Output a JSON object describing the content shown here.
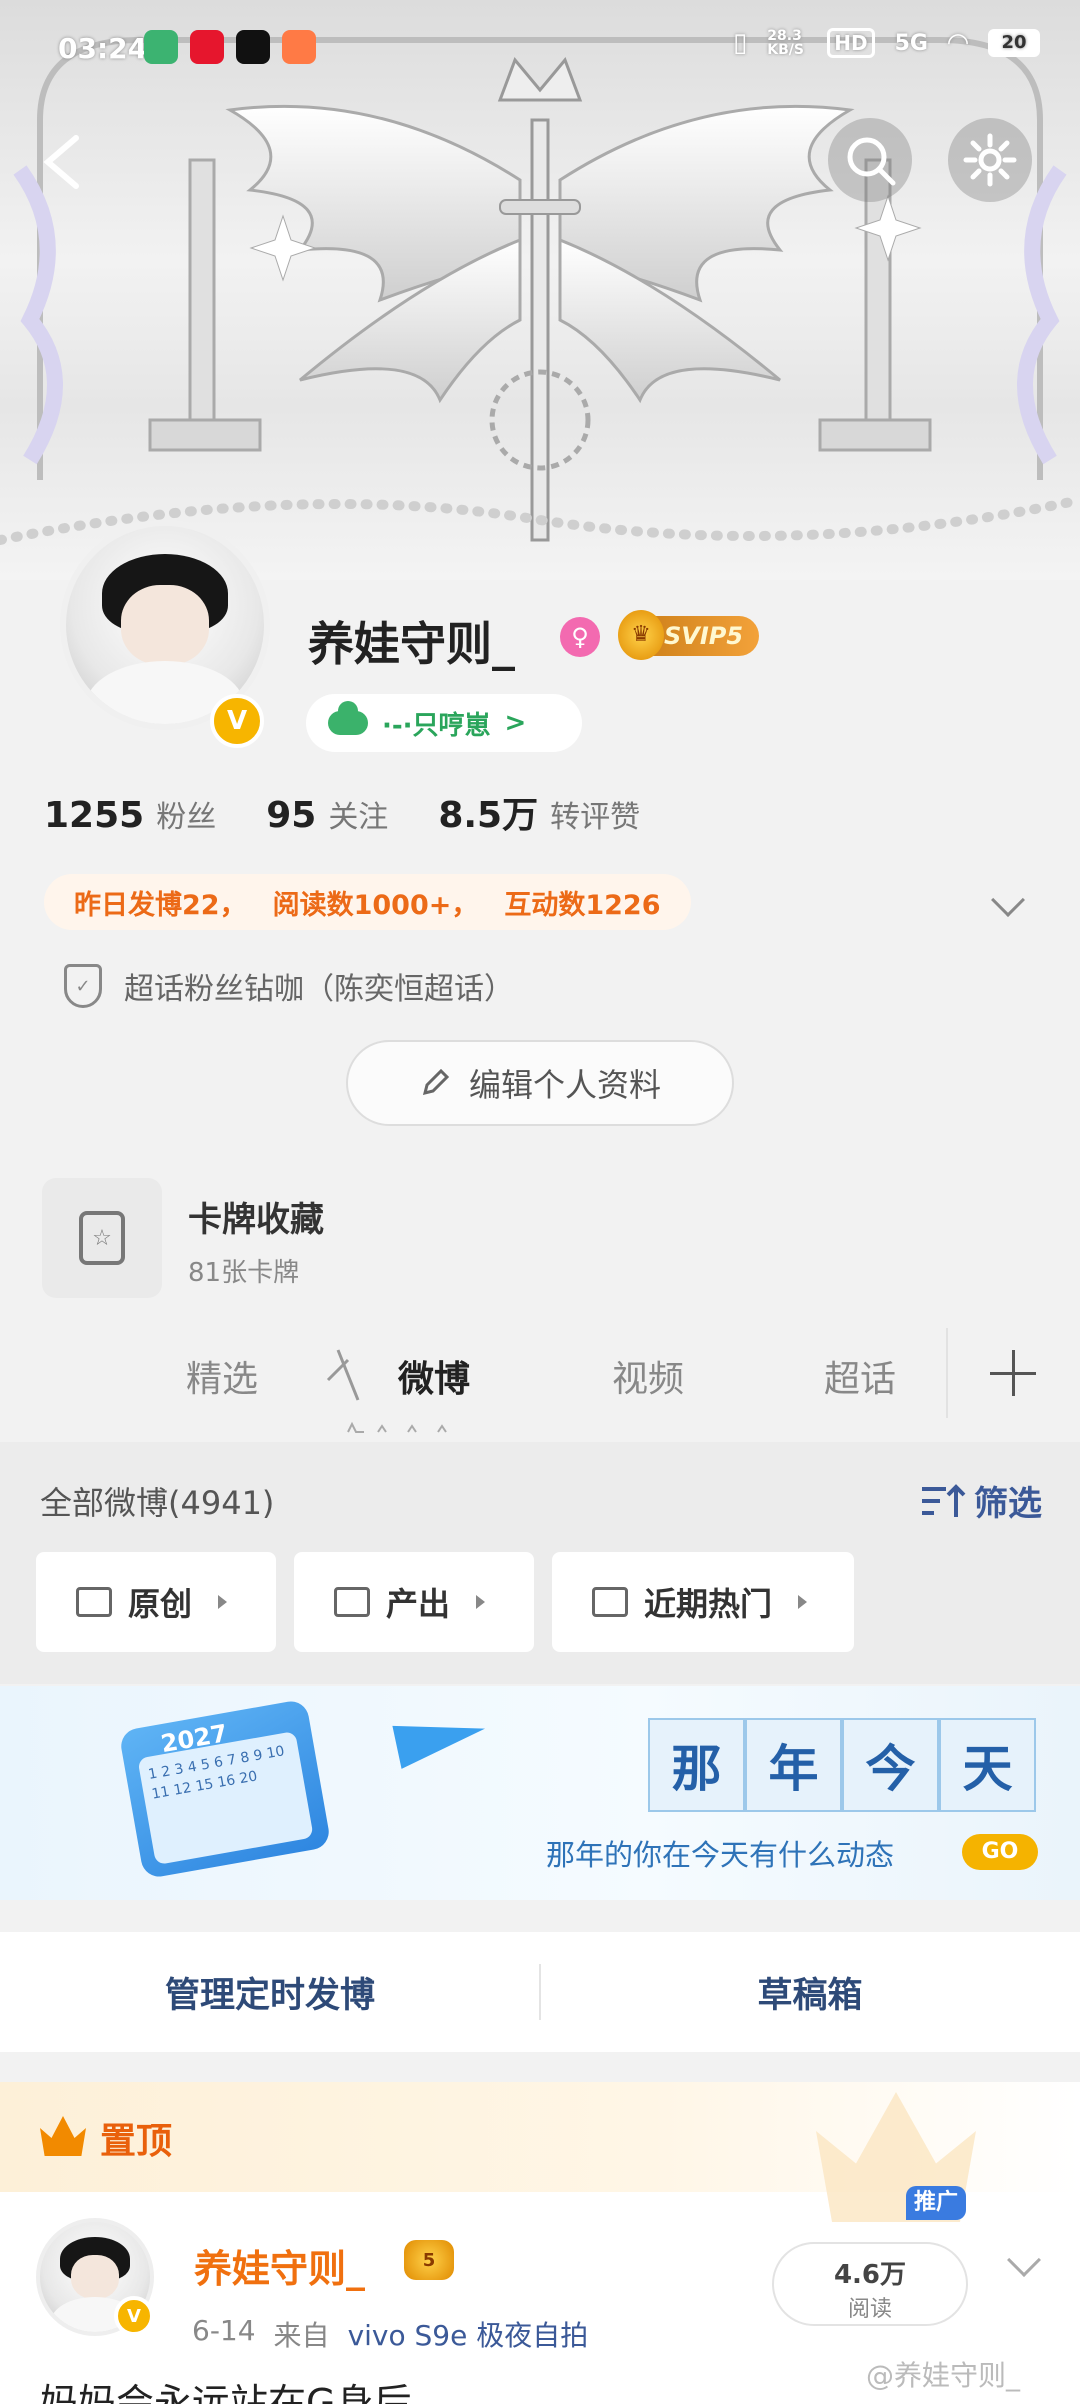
{
  "status_bar": {
    "time": "03:24",
    "net_speed": "28.3 KB/S",
    "hd": "HD",
    "signal": "5G",
    "battery": "20"
  },
  "profile": {
    "username": "养娃守则_",
    "female_symbol": "♀",
    "vip_label": "SVIP5",
    "vip_crown_icon": "crown-icon",
    "status_text": "·-·只哼崽",
    "status_chevron": ">",
    "verified_symbol": "V",
    "stats": [
      {
        "value": "1255",
        "label": "粉丝"
      },
      {
        "value": "95",
        "label": "关注"
      },
      {
        "value": "8.5万",
        "label": "转评赞"
      }
    ],
    "yesterday": [
      "昨日发博22，",
      "阅读数1000+，",
      "互动数1226"
    ],
    "super_topic": "超话粉丝钻咖（陈奕恒超话）",
    "edit_button": "编辑个人资料"
  },
  "cards": {
    "title": "卡牌收藏",
    "subtitle": "81张卡牌"
  },
  "tabs": [
    "精选",
    "微博",
    "视频",
    "超话"
  ],
  "active_tab": "微博",
  "filter": {
    "all_label": "全部微博(4941)",
    "filter_label": "筛选",
    "filter_icon": "sort-up-icon",
    "chips": [
      "原创",
      "产出",
      "近期热门"
    ]
  },
  "memory": {
    "title_chars": [
      "那",
      "年",
      "今",
      "天"
    ],
    "subtitle": "那年的你在今天有什么动态",
    "go_label": "GO",
    "calendar_year": "2027",
    "calendar_grid": "1 2 3 4 5 6 7 8 9 10 11 12 15 16 20"
  },
  "manage": {
    "scheduled": "管理定时发博",
    "drafts": "草稿箱"
  },
  "pinned": {
    "label": "置顶",
    "author": "养娃守则_",
    "author_crown": "5",
    "date": "6-14",
    "source_prefix": "来自",
    "source": "vivo S9e 极夜自拍",
    "reads_value": "4.6万",
    "reads_label": "阅读",
    "promo_label": "推广",
    "preview_text": "妈妈会永远站在G身后",
    "watermark": "@养娃守则_"
  },
  "colors": {
    "accent_orange": "#ec6a17",
    "link_blue": "#3b5998",
    "vip_gold": "#f3a23a",
    "memory_blue": "#2460a8"
  }
}
